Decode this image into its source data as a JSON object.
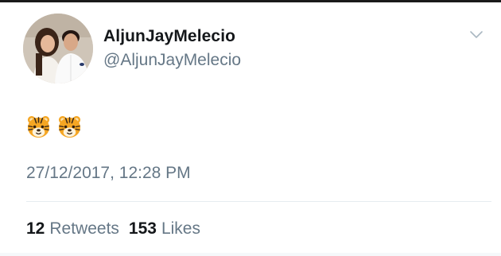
{
  "tweet": {
    "display_name": "AljunJayMelecio",
    "handle": "@AljunJayMelecio",
    "content_emojis": [
      "tiger-face-icon",
      "tiger-face-icon"
    ],
    "timestamp": "27/12/2017, 12:28 PM",
    "caret_icon": "chevron-down-icon"
  },
  "stats": {
    "retweets_count": "12",
    "retweets_label": "Retweets",
    "likes_count": "153",
    "likes_label": "Likes"
  },
  "colors": {
    "text_primary": "#14171a",
    "text_secondary": "#657786",
    "divider": "#e6ecf0",
    "tiger_orange": "#f5a623"
  }
}
